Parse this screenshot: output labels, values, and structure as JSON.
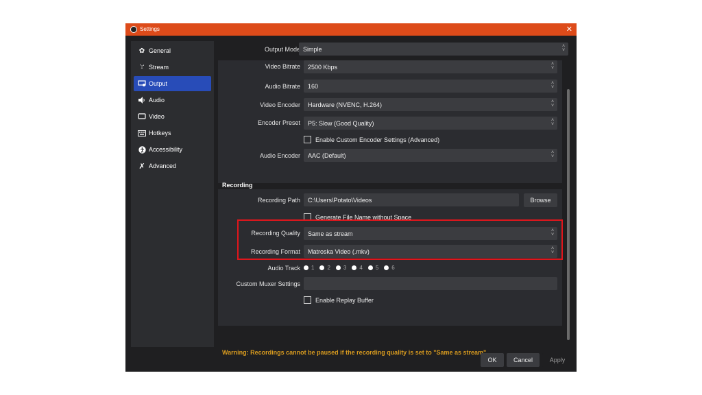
{
  "window": {
    "title": "Settings",
    "close_glyph": "✕"
  },
  "sidebar": {
    "items": [
      {
        "label": "General",
        "icon": "gear-icon",
        "glyph": "✿",
        "active": false
      },
      {
        "label": "Stream",
        "icon": "antenna-icon",
        "glyph": "`('",
        "active": false
      },
      {
        "label": "Output",
        "icon": "output-icon",
        "glyph": "▭",
        "active": true
      },
      {
        "label": "Audio",
        "icon": "speaker-icon",
        "glyph": "◀)",
        "active": false
      },
      {
        "label": "Video",
        "icon": "monitor-icon",
        "glyph": "▢",
        "active": false
      },
      {
        "label": "Hotkeys",
        "icon": "keyboard-icon",
        "glyph": "▦",
        "active": false
      },
      {
        "label": "Accessibility",
        "icon": "accessibility-icon",
        "glyph": "●",
        "active": false
      },
      {
        "label": "Advanced",
        "icon": "tools-icon",
        "glyph": "✕",
        "active": false
      }
    ]
  },
  "output_mode": {
    "label": "Output Mode",
    "value": "Simple"
  },
  "streaming": {
    "video_bitrate": {
      "label": "Video Bitrate",
      "value": "2500 Kbps"
    },
    "audio_bitrate": {
      "label": "Audio Bitrate",
      "value": "160"
    },
    "video_encoder": {
      "label": "Video Encoder",
      "value": "Hardware (NVENC, H.264)"
    },
    "encoder_preset": {
      "label": "Encoder Preset",
      "value": "P5: Slow (Good Quality)"
    },
    "custom_encoder_checkbox": "Enable Custom Encoder Settings (Advanced)",
    "audio_encoder": {
      "label": "Audio Encoder",
      "value": "AAC (Default)"
    }
  },
  "recording": {
    "section_title": "Recording",
    "path": {
      "label": "Recording Path",
      "value": "C:\\Users\\Potato\\Videos",
      "browse": "Browse"
    },
    "filename_checkbox": "Generate File Name without Space",
    "quality": {
      "label": "Recording Quality",
      "value": "Same as stream"
    },
    "format": {
      "label": "Recording Format",
      "value": "Matroska Video (.mkv)"
    },
    "audio_track": {
      "label": "Audio Track",
      "tracks": [
        "1",
        "2",
        "3",
        "4",
        "5",
        "6"
      ]
    },
    "muxer": {
      "label": "Custom Muxer Settings",
      "value": ""
    },
    "replay_checkbox": "Enable Replay Buffer"
  },
  "warning": "Warning: Recordings cannot be paused if the recording quality is set to \"Same as stream\".",
  "buttons": {
    "ok": "OK",
    "cancel": "Cancel",
    "apply": "Apply"
  },
  "colors": {
    "title_bar": "#dd4b1a",
    "active_item": "#284cb8",
    "warning": "#d79a1f",
    "highlight": "#e0161c"
  }
}
